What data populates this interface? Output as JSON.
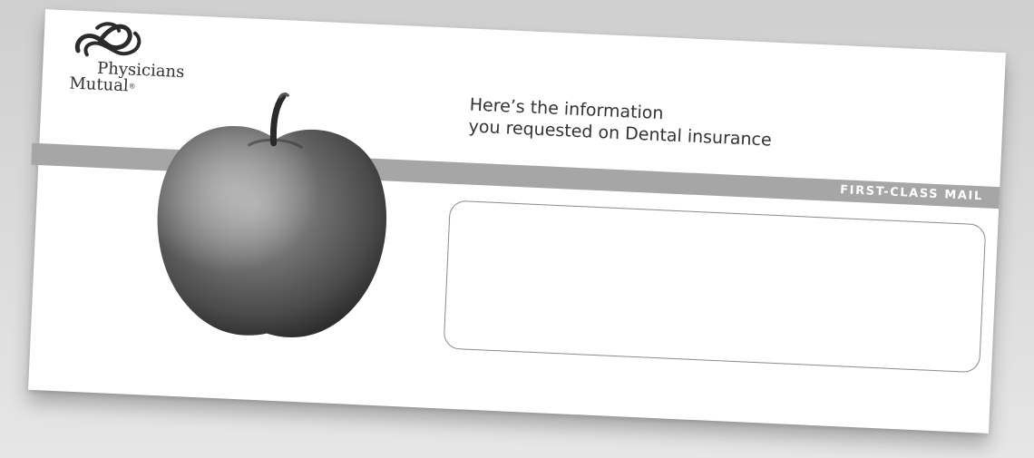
{
  "logo": {
    "line1": "Physicians",
    "line2": "Mutual",
    "registered": "®"
  },
  "headline": {
    "line1": "Here’s the information",
    "line2": "you requested on Dental insurance"
  },
  "band": {
    "label": "FIRST-CLASS MAIL"
  },
  "colors": {
    "band": "#a6a6a6",
    "text": "#333333",
    "window_border": "#8a8a8a"
  }
}
